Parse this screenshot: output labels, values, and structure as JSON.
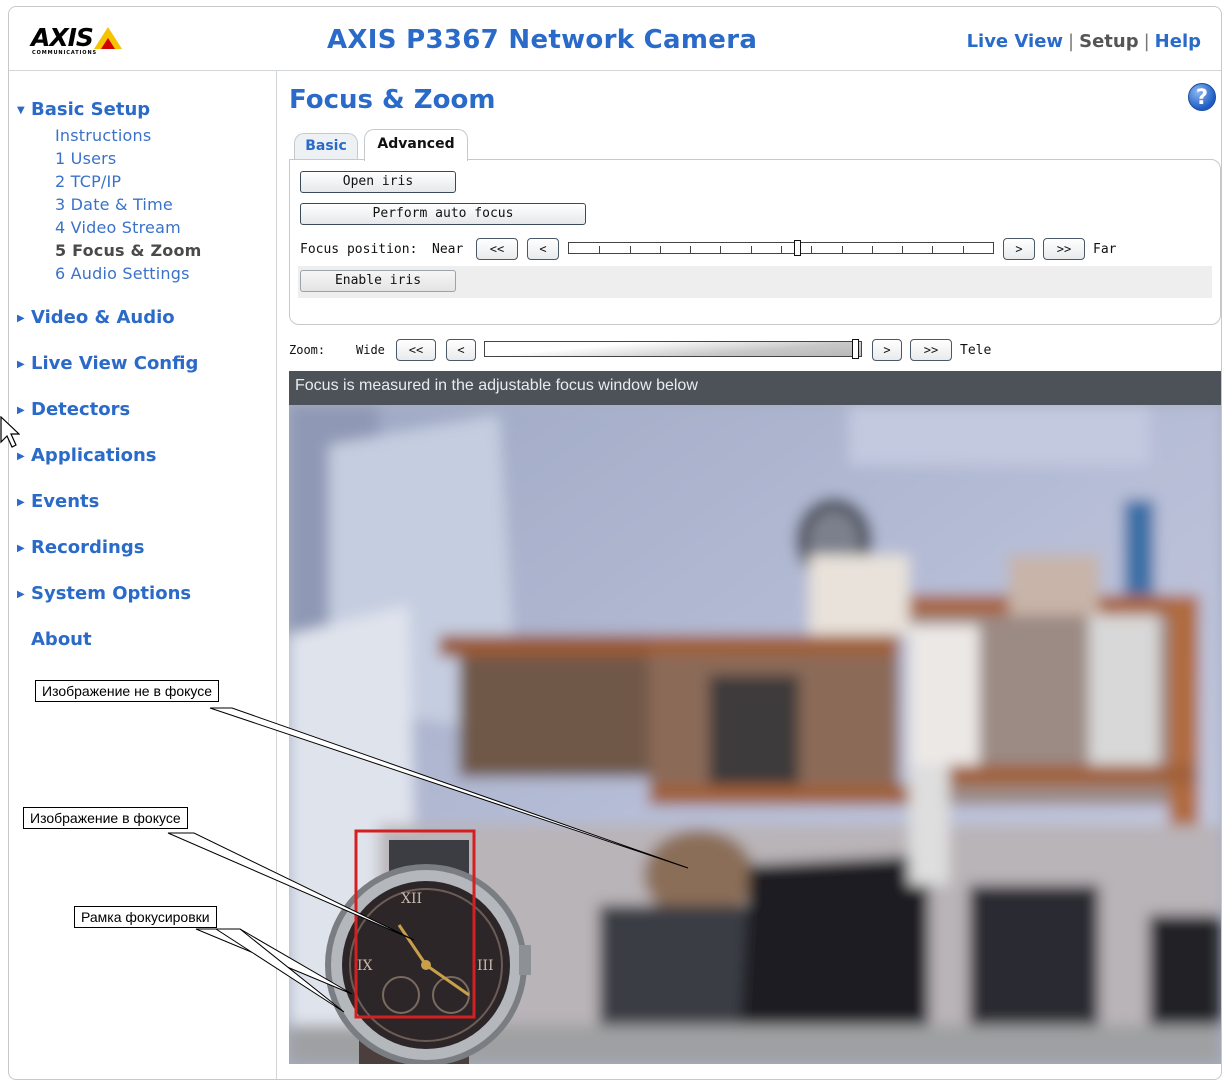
{
  "header": {
    "logo": {
      "name": "axis-logo",
      "wordmark": "AXIS",
      "sub": "COMMUNICATIONS"
    },
    "title": "AXIS P3367 Network Camera",
    "links": {
      "live_view": "Live View",
      "setup": "Setup",
      "help": "Help",
      "separator": "|"
    }
  },
  "sidebar": {
    "basic_setup": {
      "label": "Basic Setup",
      "items": [
        "Instructions",
        "1 Users",
        "2 TCP/IP",
        "3 Date & Time",
        "4 Video Stream",
        "5 Focus & Zoom",
        "6 Audio Settings"
      ],
      "active_item": "5 Focus & Zoom"
    },
    "sections": [
      "Video & Audio",
      "Live View Config",
      "Detectors",
      "Applications",
      "Events",
      "Recordings",
      "System Options"
    ],
    "about": "About"
  },
  "main": {
    "page_title": "Focus & Zoom",
    "help_icon": "question-circle-icon",
    "tabs": {
      "basic": "Basic",
      "advanced": "Advanced",
      "selected": "Advanced"
    },
    "buttons": {
      "open_iris": "Open iris",
      "auto_focus": "Perform auto focus",
      "enable_iris": "Enable iris"
    },
    "focus": {
      "label": "Focus position:",
      "near": "Near",
      "far": "Far",
      "fast_back": "<<",
      "step_back": "<",
      "step_fwd": ">",
      "fast_fwd": ">>",
      "position": 0.54
    },
    "zoom": {
      "label": "Zoom:",
      "wide": "Wide",
      "tele": "Tele",
      "fast_back": "<<",
      "step_back": "<",
      "step_fwd": ">",
      "fast_fwd": ">>",
      "position": 0.99
    },
    "video_caption": "Focus is measured in the adjustable focus window below"
  },
  "annotations": {
    "out_of_focus": "Изображение не в фокусе",
    "in_focus": "Изображение в фокусе",
    "focus_frame": "Рамка фокусировки"
  },
  "colors": {
    "accent": "#2a6ac8",
    "focus_frame": "#d42020",
    "video_bar": "#4c5257"
  }
}
